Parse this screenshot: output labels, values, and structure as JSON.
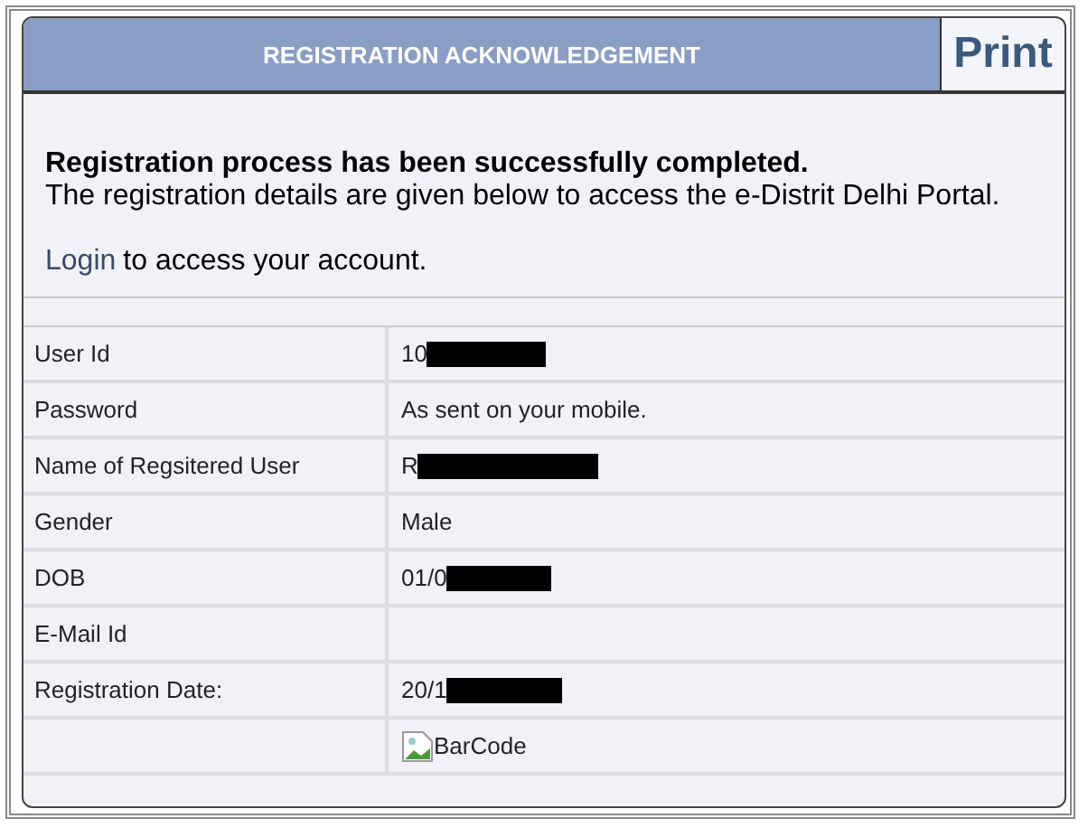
{
  "header": {
    "title": "REGISTRATION ACKNOWLEDGEMENT",
    "print_button": "Print"
  },
  "message": {
    "headline": "Registration process has been successfully completed.",
    "details": "The registration details are given below to access the e-Distrit Delhi Portal.",
    "login_link": "Login",
    "login_rest": "to access your account."
  },
  "details": [
    {
      "label": "User Id",
      "value": "10",
      "redacted": true
    },
    {
      "label": "Password",
      "value": "As sent on your mobile.",
      "redacted": false
    },
    {
      "label": "Name of Regsitered User",
      "value": "R",
      "redacted": true
    },
    {
      "label": "Gender",
      "value": "Male",
      "redacted": false
    },
    {
      "label": "DOB",
      "value": "01/0",
      "redacted": true
    },
    {
      "label": "E-Mail Id",
      "redacted": false
    },
    {
      "label": "Registration Date:",
      "value": "20/1",
      "redacted": true
    },
    {
      "kind": "image",
      "value": "BarCode",
      "redacted": false
    }
  ]
}
